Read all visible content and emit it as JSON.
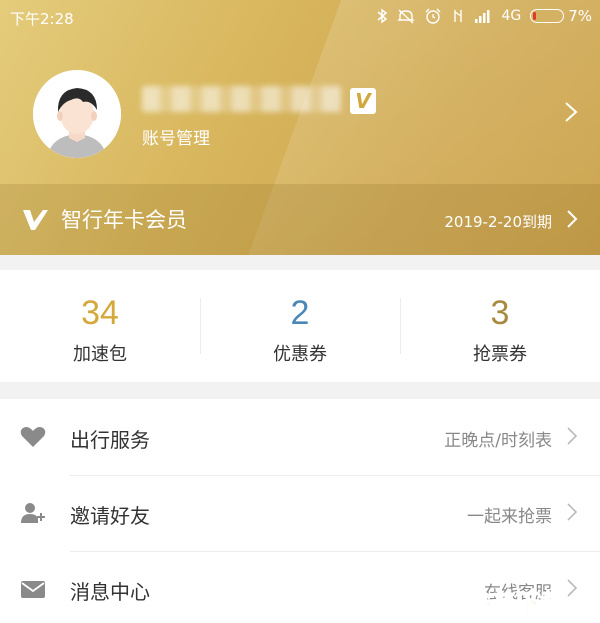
{
  "status_bar": {
    "time": "下午2:28",
    "network": "4G",
    "battery": "7%",
    "icons": [
      "bluetooth-icon",
      "mute-icon",
      "alarm-icon",
      "vibrate-icon",
      "signal-icon",
      "battery-icon"
    ]
  },
  "profile": {
    "account_link": "账号管理",
    "badge_letter": "V"
  },
  "membership": {
    "title": "智行年卡会员",
    "expiry": "2019-2-20到期",
    "logo_letter": "V"
  },
  "stats": [
    {
      "value": "34",
      "label": "加速包",
      "color": "#d4a839"
    },
    {
      "value": "2",
      "label": "优惠券",
      "color": "#4a86b8"
    },
    {
      "value": "3",
      "label": "抢票券",
      "color": "#a88a3e"
    }
  ],
  "menu": [
    {
      "label": "出行服务",
      "value": "正晚点/时刻表",
      "icon": "heart-icon"
    },
    {
      "label": "邀请好友",
      "value": "一起来抢票",
      "icon": "add-user-icon"
    },
    {
      "label": "消息中心",
      "value": "在线客服",
      "icon": "mail-icon"
    }
  ],
  "watermark": "谷普下载",
  "colors": {
    "header_gold": "#d4b258",
    "accent_gold": "#d4a839",
    "accent_blue": "#4a86b8"
  }
}
